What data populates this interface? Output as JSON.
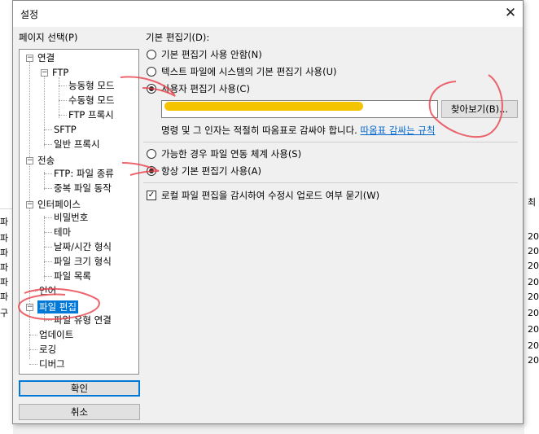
{
  "background": {
    "left_rows": [
      "파",
      "파",
      "파",
      "파",
      "파",
      "파",
      "구"
    ],
    "right_header": "최",
    "right_rows": [
      "20",
      "20",
      "20",
      "20",
      "20",
      "20",
      "20",
      "20",
      "20"
    ]
  },
  "dialog": {
    "title": "설정",
    "close_glyph": "✕",
    "page_select_label": "페이지 선택(P)",
    "tree": {
      "connection": "연결",
      "ftp": "FTP",
      "active_mode": "능동형 모드",
      "passive_mode": "수동형 모드",
      "ftp_proxy": "FTP 프록시",
      "sftp": "SFTP",
      "generic_proxy": "일반 프록시",
      "transfers": "전송",
      "ftp_file_types": "FTP: 파일 종류",
      "duplicate_action": "중복 파일 동작",
      "interface": "인터페이스",
      "passwords": "비밀번호",
      "theme": "테마",
      "datetime_format": "날짜/시간 형식",
      "filesize_format": "파일 크기 형식",
      "file_lists": "파일 목록",
      "language": "언어",
      "file_editing": "파일 편집",
      "filetype_assoc": "파일 유형 연결",
      "updates": "업데이트",
      "logging": "로깅",
      "debug": "디버그",
      "expander_minus": "−"
    },
    "ok_label": "확인",
    "cancel_label": "취소",
    "default_editor": {
      "heading": "기본 편집기(D):",
      "opt_none": "기본 편집기 사용 안함(N)",
      "opt_system": "텍스트 파일에 시스템의 기본 편집기 사용(U)",
      "opt_custom": "사용자 편집기 사용(C)",
      "selected": "custom",
      "custom_path_value": "",
      "browse_label": "찾아보기(B)...",
      "hint_text": "명령 및 그 인자는 적절히 따옴표로 감싸야 합니다.",
      "hint_link": "따옴표 감싸는 규칙"
    },
    "assoc": {
      "opt_use_assoc": "가능한 경우 파일 연동 체계 사용(S)",
      "opt_always_default": "항상 기본 편집기 사용(A)",
      "selected": "always_default"
    },
    "watch_local_label": "로컬 파일 편집을 감시하여 수정시 업로드 여부 묻기(W)",
    "watch_local_checked": true,
    "check_glyph": "✓"
  },
  "annotation_color": "#e8404a",
  "redaction_color": "#f5c400"
}
